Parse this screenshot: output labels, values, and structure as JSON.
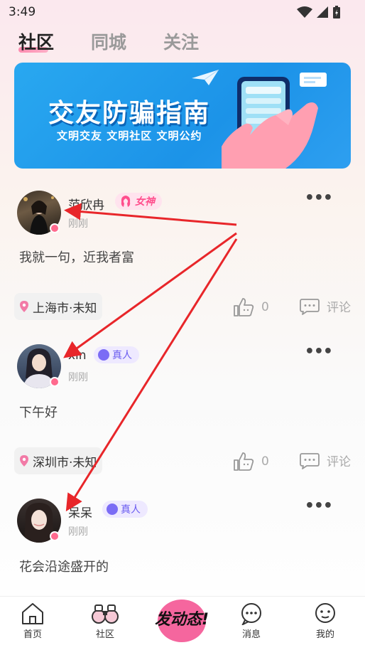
{
  "status_bar": {
    "time": "3:49"
  },
  "tabs": [
    {
      "label": "社区",
      "active": true
    },
    {
      "label": "同城",
      "active": false
    },
    {
      "label": "关注",
      "active": false
    }
  ],
  "banner": {
    "title": "交友防骗指南",
    "subtitle": "文明交友  文明社区  文明公约"
  },
  "posts": [
    {
      "username": "范欣冉",
      "badge": "女神",
      "badge_type": "goddess",
      "time": "刚刚",
      "content": "我就一句，近我者富",
      "location": "上海市·未知",
      "likes": "0",
      "comment_label": "评论"
    },
    {
      "username": "xin",
      "badge": "真人",
      "badge_type": "real",
      "time": "刚刚",
      "content": "下午好",
      "location": "深圳市·未知",
      "likes": "0",
      "comment_label": "评论"
    },
    {
      "username": "呆呆",
      "badge": "真人",
      "badge_type": "real",
      "time": "刚刚",
      "content": "花会沿途盛开的"
    }
  ],
  "more_glyph": "•••",
  "nav": {
    "home": "首页",
    "community": "社区",
    "post": "发动态!",
    "messages": "消息",
    "mine": "我的"
  },
  "colors": {
    "accent": "#ff4f8d",
    "annotation_arrow": "#e8262a",
    "banner_bg": "#1c93e8"
  }
}
